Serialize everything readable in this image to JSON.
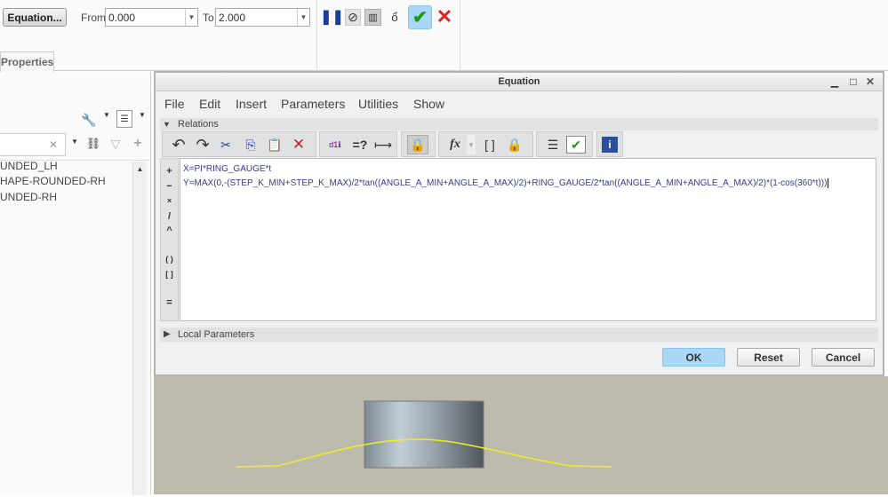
{
  "ribbon": {
    "equation_button": "Equation...",
    "from_label": "From",
    "from_value": "0.000",
    "to_label": "To",
    "to_value": "2.000",
    "properties_tab": "Properties"
  },
  "left_panel": {
    "items": [
      "UNDED_LH",
      "HAPE-ROUNDED-RH",
      "UNDED-RH"
    ]
  },
  "dialog": {
    "title": "Equation",
    "menu": [
      "File",
      "Edit",
      "Insert",
      "Parameters",
      "Utilities",
      "Show"
    ],
    "relations_label": "Relations",
    "operators": [
      "+",
      "−",
      "×",
      "/",
      "^",
      "( )",
      "[ ]",
      "="
    ],
    "relations": [
      "X=PI*RING_GAUGE*t",
      "Y=MAX(0,-(STEP_K_MIN+STEP_K_MAX)/2*tan((ANGLE_A_MIN+ANGLE_A_MAX)/2)+RING_GAUGE/2*tan((ANGLE_A_MIN+ANGLE_A_MAX)/2)*(1-cos(360*t)))"
    ],
    "local_parameters_label": "Local Parameters",
    "ok": "OK",
    "reset": "Reset",
    "cancel": "Cancel"
  },
  "colors": {
    "ok_blue": "#a9d8f7",
    "curve": "#f0f020",
    "viewport": "#bdbaae",
    "cancel_red": "#d22"
  }
}
